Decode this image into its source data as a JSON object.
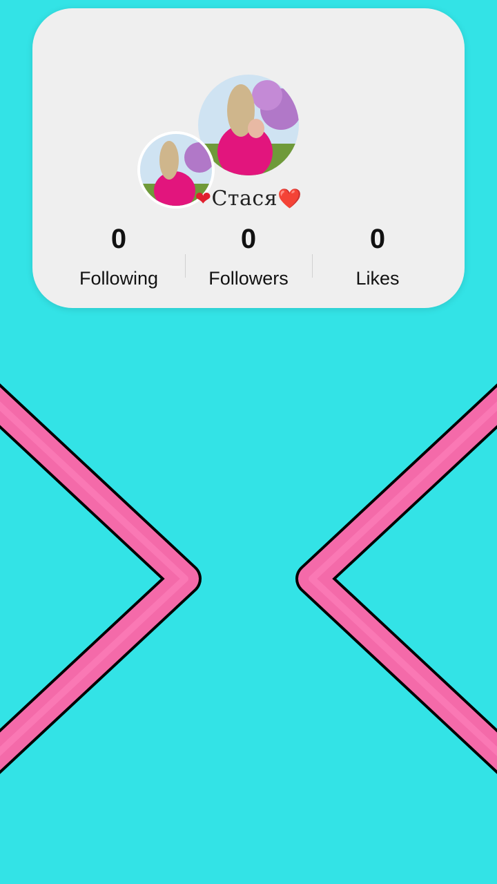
{
  "profile": {
    "username_left_icon": "❤",
    "username_text": "Стася",
    "username_right_icon": "❤️",
    "avatar_large_icon": "profile-photo",
    "avatar_small_icon": "profile-photo"
  },
  "stats": {
    "following": {
      "value": "0",
      "label": "Following"
    },
    "followers": {
      "value": "0",
      "label": "Followers"
    },
    "likes": {
      "value": "0",
      "label": "Likes"
    }
  },
  "colors": {
    "background": "#33e3e6",
    "card": "#efefef",
    "chevron_fill": "#f46aa9",
    "chevron_outline": "#000000",
    "heart": "#e0202e"
  }
}
